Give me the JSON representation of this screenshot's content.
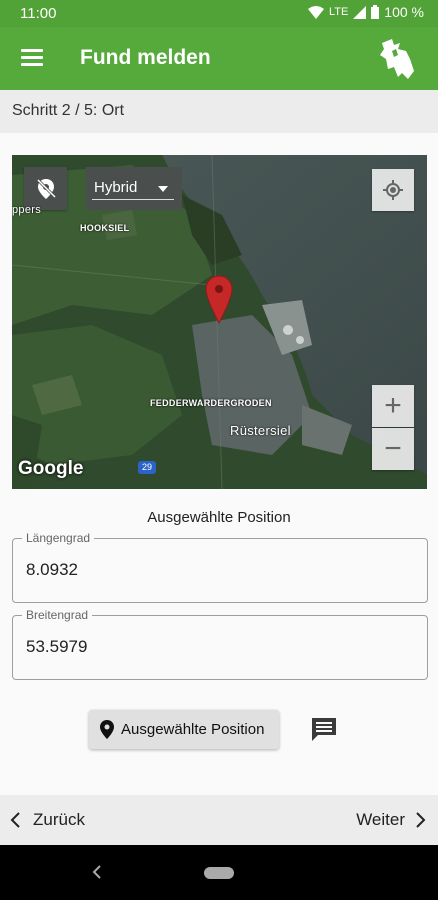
{
  "status_bar": {
    "time": "11:00",
    "network": "LTE",
    "battery": "100 %"
  },
  "app_bar": {
    "title": "Fund melden"
  },
  "step": {
    "label": "Schritt 2 / 5: Ort"
  },
  "map": {
    "map_type": "Hybrid",
    "labels": {
      "hooksiel": "HOOKSIEL",
      "ippers": "ppers",
      "fedderwardergroden": "FEDDERWARDERGRODEN",
      "ruestersiel": "Rüstersiel"
    },
    "road_number": "29",
    "attribution": "Google",
    "zoom_in": "+",
    "zoom_out": "−"
  },
  "position": {
    "title": "Ausgewählte Position",
    "longitude_label": "Längengrad",
    "longitude_value": "8.0932",
    "latitude_label": "Breitengrad",
    "latitude_value": "53.5979",
    "button_label": "Ausgewählte Position"
  },
  "navigation": {
    "back_label": "Zurück",
    "next_label": "Weiter"
  },
  "colors": {
    "primary": "#56aa3b",
    "marker": "#c62828"
  },
  "icons": [
    "menu-icon",
    "logo-icon",
    "location-off-icon",
    "gps-icon",
    "map-pin-icon",
    "comment-icon",
    "chevron-left-icon",
    "chevron-right-icon"
  ]
}
